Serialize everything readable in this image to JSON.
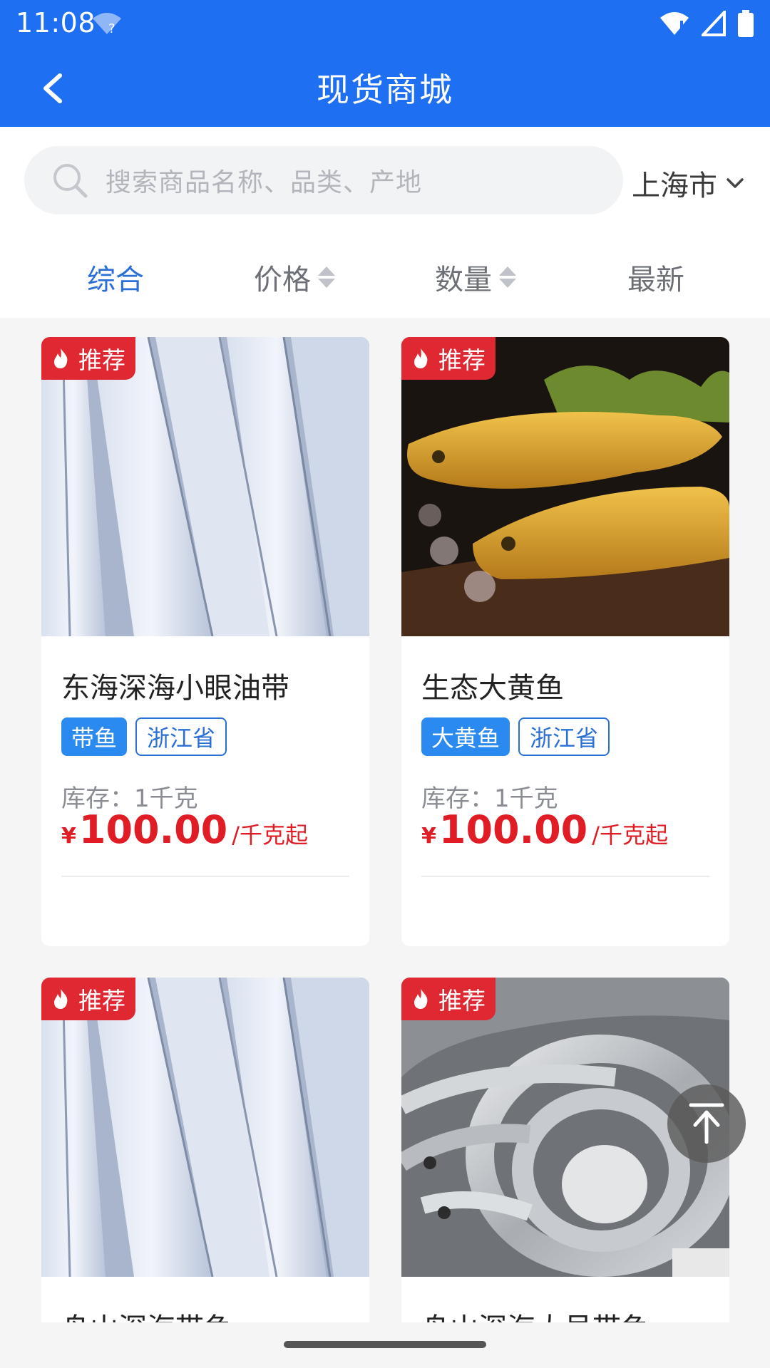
{
  "status_bar": {
    "time": "11:08"
  },
  "navbar": {
    "title": "现货商城"
  },
  "search": {
    "placeholder": "搜索商品名称、品类、产地",
    "city": "上海市"
  },
  "sort_tabs": [
    {
      "label": "综合",
      "active": true
    },
    {
      "label": "价格",
      "sortable": true
    },
    {
      "label": "数量",
      "sortable": true
    },
    {
      "label": "最新"
    }
  ],
  "products": [
    {
      "badge": "推荐",
      "title": "东海深海小眼油带",
      "category_tag": "带鱼",
      "origin_tag": "浙江省",
      "stock": "库存：1千克",
      "currency": "¥",
      "price": "100.00",
      "unit": "/千克起"
    },
    {
      "badge": "推荐",
      "title": "生态大黄鱼",
      "category_tag": "大黄鱼",
      "origin_tag": "浙江省",
      "stock": "库存：1千克",
      "currency": "¥",
      "price": "100.00",
      "unit": "/千克起"
    },
    {
      "badge": "推荐",
      "title": "舟山深海带鱼"
    },
    {
      "badge": "推荐",
      "title": "舟山深海大号带鱼"
    }
  ],
  "colors": {
    "header_blue": "#1f6ff2",
    "price_red": "#e01c25",
    "badge_red": "#e02833",
    "active_tab": "#2a6fd6"
  }
}
